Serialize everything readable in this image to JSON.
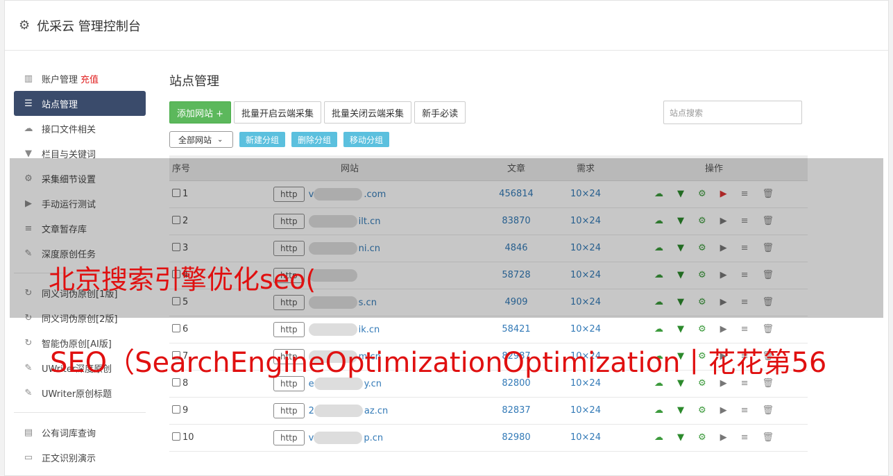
{
  "header": {
    "title": "优采云 管理控制台"
  },
  "sidebar": {
    "recharge": "充值",
    "items": [
      {
        "label": "账户管理",
        "icon": "bar-chart-icon"
      },
      {
        "label": "站点管理",
        "icon": "server-icon"
      },
      {
        "label": "接口文件相关",
        "icon": "cloud-upload-icon"
      },
      {
        "label": "栏目与关键词",
        "icon": "filter-icon"
      },
      {
        "label": "采集细节设置",
        "icon": "gears-icon"
      },
      {
        "label": "手动运行测试",
        "icon": "play-icon"
      },
      {
        "label": "文章暂存库",
        "icon": "database-icon"
      },
      {
        "label": "深度原创任务",
        "icon": "edit-icon"
      },
      {
        "label": "同义词伪原创[1版]",
        "icon": "refresh-icon"
      },
      {
        "label": "同义词伪原创[2版]",
        "icon": "refresh-icon"
      },
      {
        "label": "智能伪原创[AI版]",
        "icon": "refresh-icon"
      },
      {
        "label": "UWriter深度原创",
        "icon": "edit-icon"
      },
      {
        "label": "UWriter原创标题",
        "icon": "edit-icon"
      },
      {
        "label": "公有词库查询",
        "icon": "book-icon"
      },
      {
        "label": "正文识别演示",
        "icon": "monitor-icon"
      }
    ]
  },
  "main": {
    "title": "站点管理",
    "add_site": "添加网站 +",
    "batch_open": "批量开启云端采集",
    "batch_close": "批量关闭云端采集",
    "newbie": "新手必读",
    "search_placeholder": "站点搜索",
    "group_select": "全部网站",
    "new_group": "新建分组",
    "delete_group": "删除分组",
    "move_group": "移动分组"
  },
  "table": {
    "headers": {
      "no": "序号",
      "site": "网站",
      "articles": "文章",
      "demand": "需求",
      "ops": "操作"
    },
    "http_label": "http",
    "rows": [
      {
        "no": "1",
        "site_prefix": "v",
        "site_suffix": ".com",
        "articles": "456814",
        "demand": "10×24"
      },
      {
        "no": "2",
        "site_prefix": "",
        "site_suffix": "ilt.cn",
        "articles": "83870",
        "demand": "10×24"
      },
      {
        "no": "3",
        "site_prefix": "",
        "site_suffix": "ni.cn",
        "articles": "4846",
        "demand": "10×24"
      },
      {
        "no": "4",
        "site_prefix": "",
        "site_suffix": "",
        "articles": "58728",
        "demand": "10×24"
      },
      {
        "no": "5",
        "site_prefix": "",
        "site_suffix": "s.cn",
        "articles": "4909",
        "demand": "10×24"
      },
      {
        "no": "6",
        "site_prefix": "",
        "site_suffix": "ik.cn",
        "articles": "58421",
        "demand": "10×24"
      },
      {
        "no": "7",
        "site_prefix": "",
        "site_suffix": "m.cn",
        "articles": "82987",
        "demand": "10×24"
      },
      {
        "no": "8",
        "site_prefix": "e",
        "site_suffix": "y.cn",
        "articles": "82800",
        "demand": "10×24"
      },
      {
        "no": "9",
        "site_prefix": "2",
        "site_suffix": "az.cn",
        "articles": "82837",
        "demand": "10×24"
      },
      {
        "no": "10",
        "site_prefix": "v",
        "site_suffix": "p.cn",
        "articles": "82980",
        "demand": "10×24"
      }
    ]
  },
  "watermark": {
    "line1": "北京搜索引擎优化seo(",
    "line2": "SEO（SearchEngineOptimizationOptimization丨花花第56"
  },
  "colors": {
    "accent_green": "#5cb85c",
    "sidebar_active": "#3a4b6b",
    "info_blue": "#5bc0de",
    "link_blue": "#337ab7",
    "watermark_red": "#e01010"
  }
}
